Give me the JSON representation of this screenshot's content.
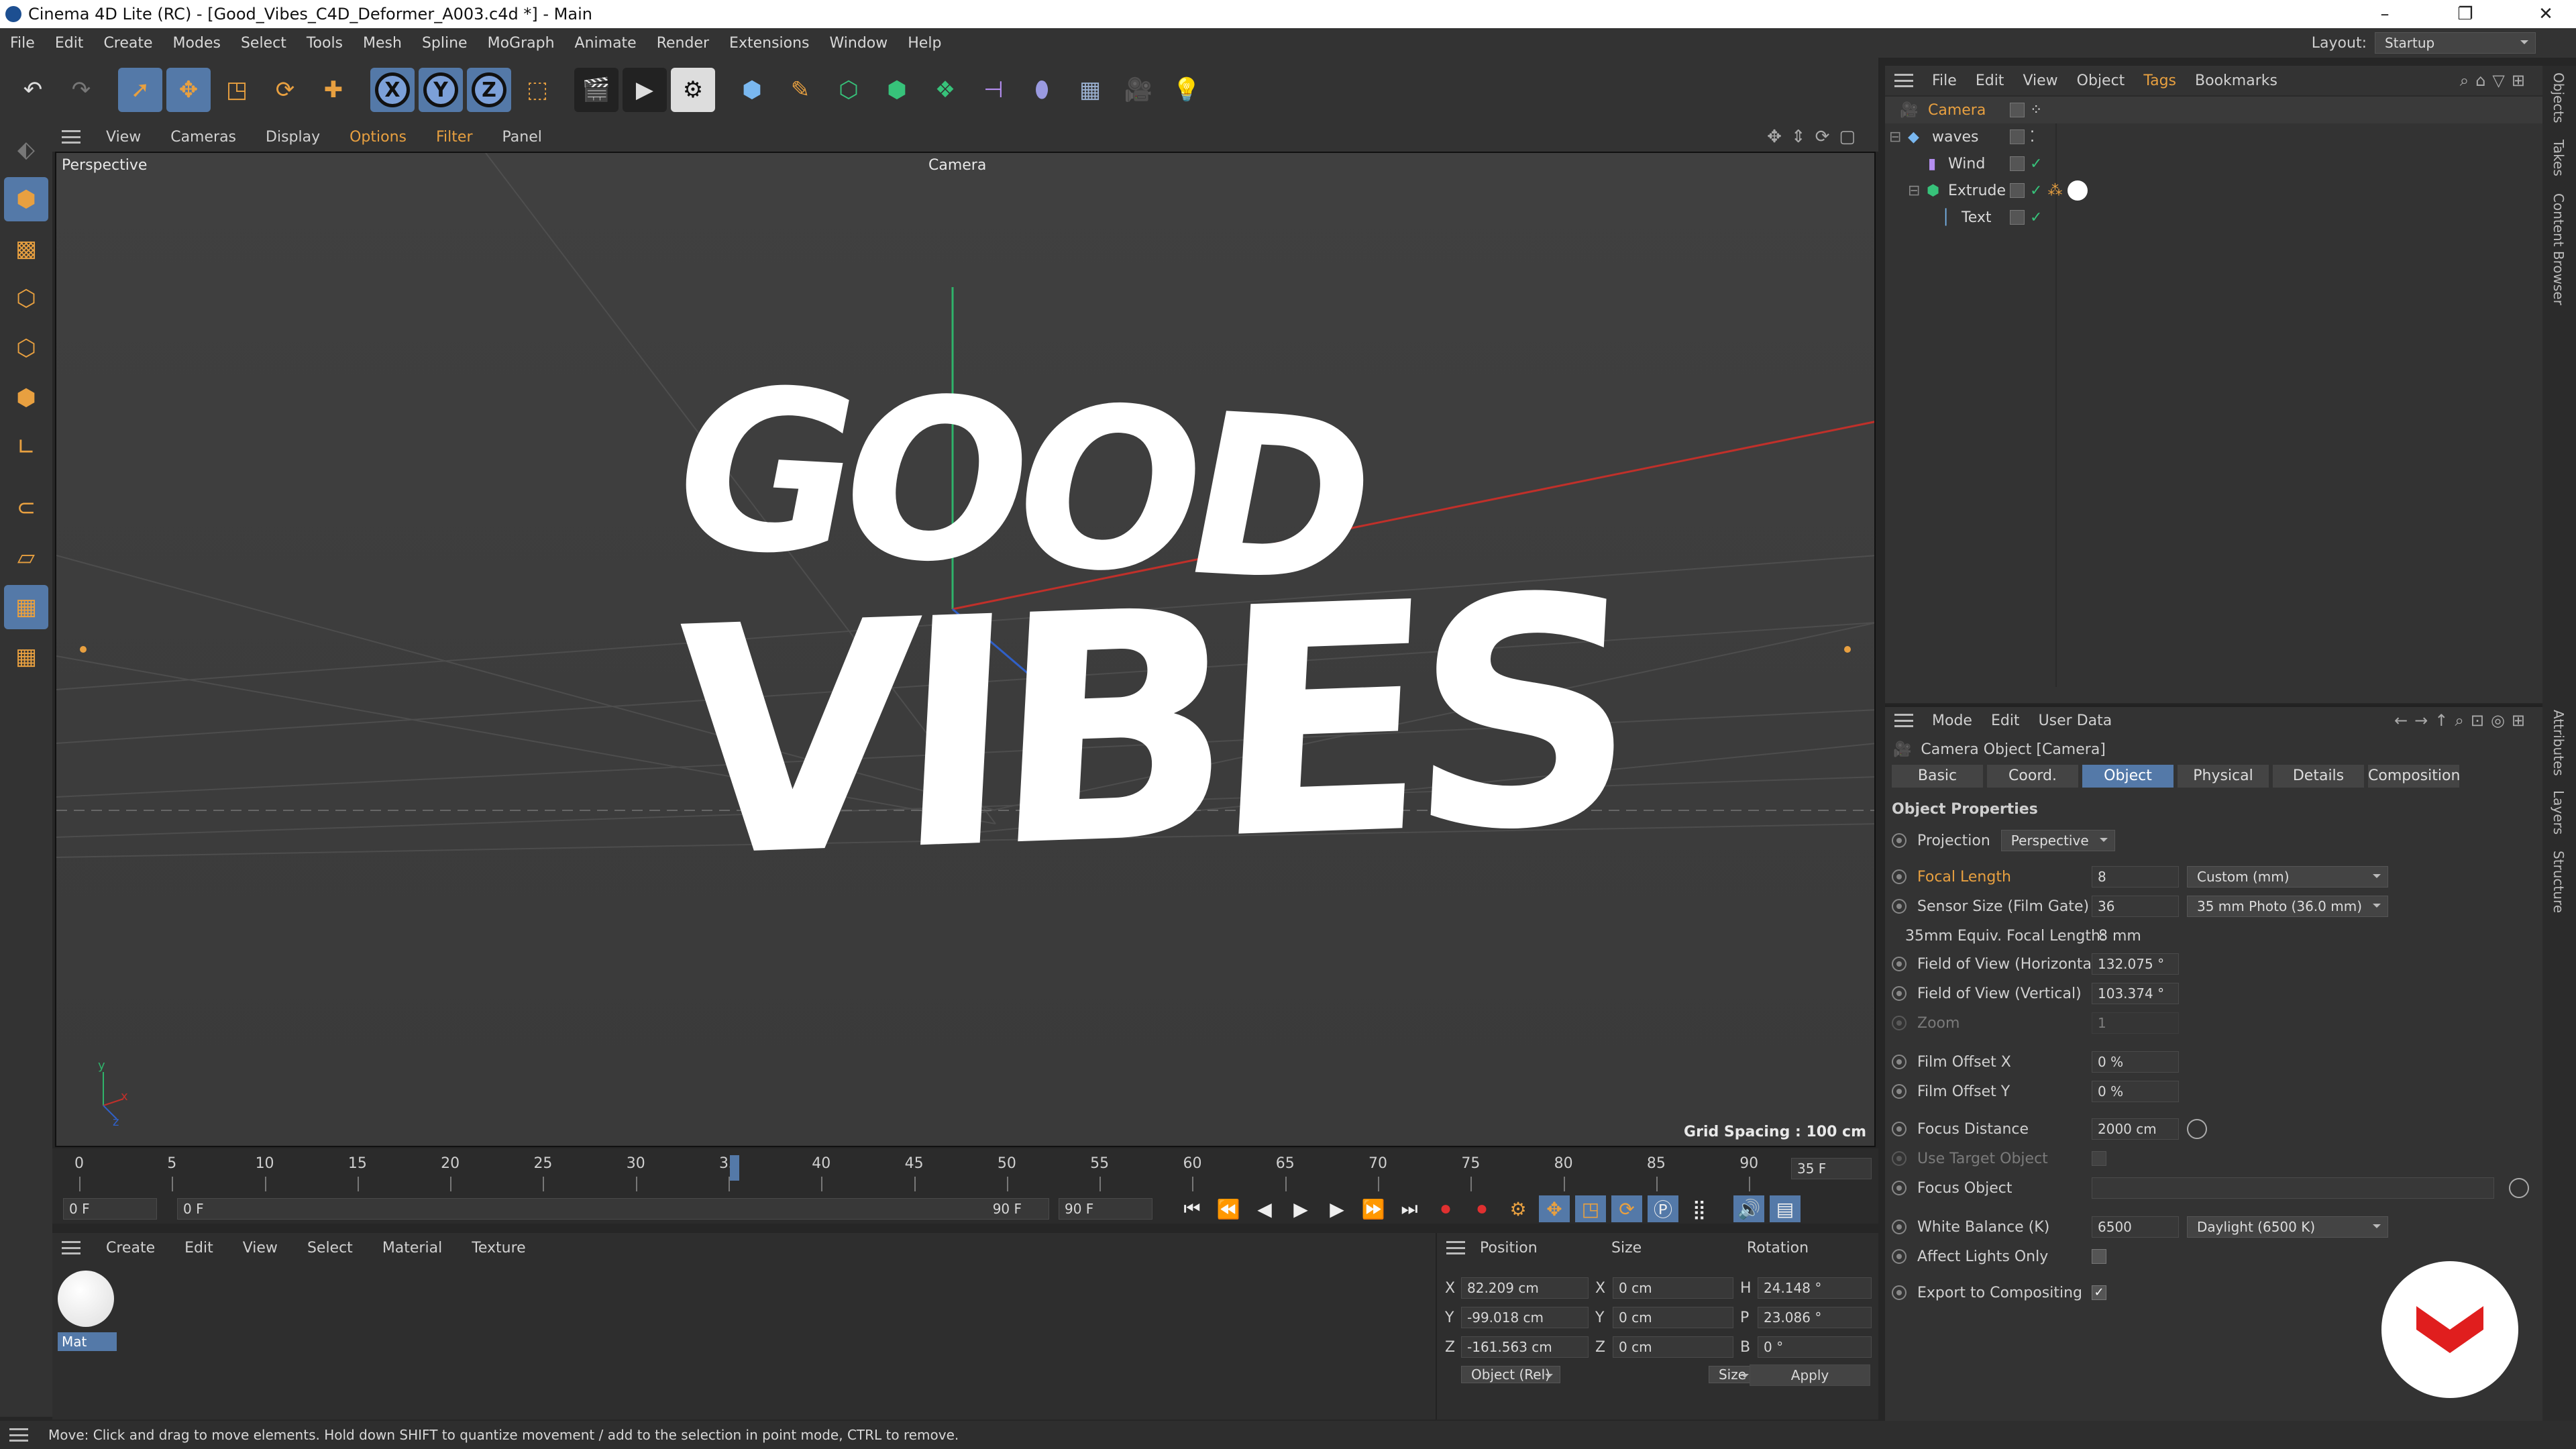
{
  "window": {
    "title": "Cinema 4D Lite (RC) - [Good_Vibes_C4D_Deformer_A003.c4d *] - Main",
    "minimize": "–",
    "maximize": "❐",
    "close": "✕"
  },
  "menubar": {
    "items": [
      "File",
      "Edit",
      "Create",
      "Modes",
      "Select",
      "Tools",
      "Mesh",
      "Spline",
      "MoGraph",
      "Animate",
      "Render",
      "Extensions",
      "Window",
      "Help"
    ],
    "layout_label": "Layout:",
    "layout_value": "Startup"
  },
  "toolbar": {
    "undo": "↶",
    "redo": "↷",
    "axis_x": "X",
    "axis_y": "Y",
    "axis_z": "Z"
  },
  "viewport": {
    "menu": [
      "View",
      "Cameras",
      "Display",
      "Options",
      "Filter",
      "Panel"
    ],
    "label": "Perspective",
    "camera_label": "Camera",
    "grid_spacing": "Grid Spacing : 100 cm",
    "scene_text_line1": "GOOD",
    "scene_text_line2": "VIBES",
    "axis_y": "y",
    "axis_x": "x",
    "axis_z": "z"
  },
  "timeline": {
    "ticks": [
      "0",
      "5",
      "10",
      "15",
      "20",
      "25",
      "30",
      "35",
      "40",
      "45",
      "50",
      "55",
      "60",
      "65",
      "70",
      "75",
      "80",
      "85",
      "90"
    ],
    "current_frame": "35 F",
    "start_field": "0 F",
    "range_start": "0 F",
    "range_end": "90 F",
    "end_field": "90 F"
  },
  "material_manager": {
    "menu": [
      "Create",
      "Edit",
      "View",
      "Select",
      "Material",
      "Texture"
    ],
    "material_name": "Mat"
  },
  "coordinates": {
    "headers": [
      "Position",
      "Size",
      "Rotation"
    ],
    "rows": [
      {
        "axis": "X",
        "pos": "82.209 cm",
        "size_axis": "X",
        "size": "0 cm",
        "rot_axis": "H",
        "rot": "24.148 °"
      },
      {
        "axis": "Y",
        "pos": "-99.018 cm",
        "size_axis": "Y",
        "size": "0 cm",
        "rot_axis": "P",
        "rot": "23.086 °"
      },
      {
        "axis": "Z",
        "pos": "-161.563 cm",
        "size_axis": "Z",
        "size": "0 cm",
        "rot_axis": "B",
        "rot": "0 °"
      }
    ],
    "mode_select": "Object (Rel)",
    "size_select": "Size",
    "apply": "Apply"
  },
  "object_manager": {
    "menu": [
      "File",
      "Edit",
      "View",
      "Object",
      "Tags",
      "Bookmarks"
    ],
    "objects": [
      "Camera",
      "waves",
      "Wind",
      "Extrude",
      "Text"
    ]
  },
  "attributes": {
    "menu": [
      "Mode",
      "Edit",
      "User Data"
    ],
    "object_title": "Camera Object [Camera]",
    "tabs": [
      "Basic",
      "Coord.",
      "Object",
      "Physical",
      "Details",
      "Composition"
    ],
    "section": "Object Properties",
    "projection_label": "Projection",
    "projection_value": "Perspective",
    "focal_length_label": "Focal Length",
    "focal_length_value": "8",
    "focal_length_preset": "Custom (mm)",
    "sensor_label": "Sensor Size (Film Gate)",
    "sensor_value": "36",
    "sensor_preset": "35 mm Photo (36.0 mm)",
    "equiv_label": "35mm Equiv. Focal Length:",
    "equiv_value": "8 mm",
    "fov_h_label": "Field of View (Horizontal)",
    "fov_h_value": "132.075 °",
    "fov_v_label": "Field of View (Vertical)",
    "fov_v_value": "103.374 °",
    "zoom_label": "Zoom",
    "zoom_value": "1",
    "film_x_label": "Film Offset X",
    "film_x_value": "0 %",
    "film_y_label": "Film Offset Y",
    "film_y_value": "0 %",
    "focus_dist_label": "Focus Distance",
    "focus_dist_value": "2000 cm",
    "use_target_label": "Use Target Object",
    "focus_obj_label": "Focus Object",
    "wb_label": "White Balance (K)",
    "wb_value": "6500",
    "wb_preset": "Daylight (6500 K)",
    "affect_lights_label": "Affect Lights Only",
    "export_label": "Export to Compositing"
  },
  "side_tabs": [
    "Objects",
    "Takes",
    "Content Browser",
    "Attributes",
    "Layers",
    "Structure"
  ],
  "status": {
    "text": "Move: Click and drag to move elements. Hold down SHIFT to quantize movement / add to the selection in point mode, CTRL to remove."
  },
  "colors": {
    "accent": "#5479a8",
    "highlight_orange": "#e8a040",
    "logo_red": "#e01e1e"
  }
}
